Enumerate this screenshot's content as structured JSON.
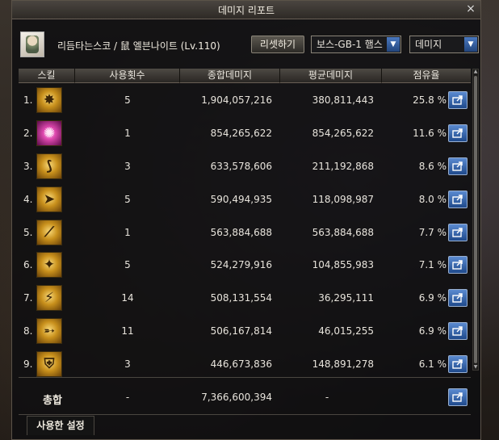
{
  "window": {
    "title": "데미지 리포트",
    "close_glyph": "×"
  },
  "toolbar": {
    "character_name": "리듬타는스코 / 鼠 엘븐나이트 (Lv.110)",
    "reset_label": "리셋하기",
    "boss_select_value": "보스-GB-1 햄스",
    "metric_select_value": "데미지",
    "dropdown_glyph": "▼"
  },
  "table": {
    "headers": [
      "스킬",
      "사용횟수",
      "종합데미지",
      "평균데미지",
      "점유율"
    ],
    "rows": [
      {
        "rank": "1.",
        "icon": "skill-icon",
        "glyph": "✸",
        "count": "5",
        "total": "1,904,057,216",
        "avg": "380,811,443",
        "share": "25.8 %"
      },
      {
        "rank": "2.",
        "icon": "skill-icon",
        "glyph": "✺",
        "count": "1",
        "total": "854,265,622",
        "avg": "854,265,622",
        "share": "11.6 %"
      },
      {
        "rank": "3.",
        "icon": "skill-icon",
        "glyph": "⟆",
        "count": "3",
        "total": "633,578,606",
        "avg": "211,192,868",
        "share": "8.6 %"
      },
      {
        "rank": "4.",
        "icon": "skill-icon",
        "glyph": "➤",
        "count": "5",
        "total": "590,494,935",
        "avg": "118,098,987",
        "share": "8.0 %"
      },
      {
        "rank": "5.",
        "icon": "skill-icon",
        "glyph": "⟋",
        "count": "1",
        "total": "563,884,688",
        "avg": "563,884,688",
        "share": "7.7 %"
      },
      {
        "rank": "6.",
        "icon": "skill-icon",
        "glyph": "✦",
        "count": "5",
        "total": "524,279,916",
        "avg": "104,855,983",
        "share": "7.1 %"
      },
      {
        "rank": "7.",
        "icon": "skill-icon",
        "glyph": "⚡",
        "count": "14",
        "total": "508,131,554",
        "avg": "36,295,111",
        "share": "6.9 %"
      },
      {
        "rank": "8.",
        "icon": "skill-icon",
        "glyph": "➵",
        "count": "11",
        "total": "506,167,814",
        "avg": "46,015,255",
        "share": "6.9 %"
      },
      {
        "rank": "9.",
        "icon": "skill-icon",
        "glyph": "⛨",
        "count": "3",
        "total": "446,673,836",
        "avg": "148,891,278",
        "share": "6.1 %"
      }
    ],
    "totals": {
      "label": "총합",
      "count": "-",
      "total": "7,366,600,394",
      "avg": "-"
    }
  },
  "settings_tab_label": "사용한 설정",
  "colors": {
    "accent_blue": "#2f5fa8",
    "gold": "#d4a020",
    "window_bg": "#0e0e10"
  }
}
